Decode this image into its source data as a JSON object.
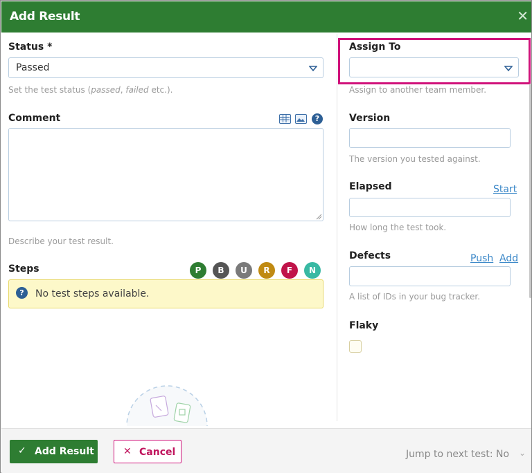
{
  "dialog": {
    "title": "Add Result",
    "close_icon": "close-icon"
  },
  "status": {
    "label": "Status",
    "required_mark": "*",
    "value": "Passed",
    "hint_prefix": "Set the test status (",
    "hint_italic_1": "passed",
    "hint_sep": ", ",
    "hint_italic_2": "failed",
    "hint_suffix": " etc.)."
  },
  "comment": {
    "label": "Comment",
    "value": "",
    "hint": "Describe your test result.",
    "toolbar_icons": [
      "table-icon",
      "image-icon",
      "help-icon"
    ]
  },
  "steps": {
    "label": "Steps",
    "statuses": [
      {
        "letter": "P",
        "name": "passed",
        "color": "#2e7d32"
      },
      {
        "letter": "B",
        "name": "blocked",
        "color": "#555555"
      },
      {
        "letter": "U",
        "name": "untested",
        "color": "#7a7a7a"
      },
      {
        "letter": "R",
        "name": "retest",
        "color": "#c08a12"
      },
      {
        "letter": "F",
        "name": "failed",
        "color": "#c0144a"
      },
      {
        "letter": "N",
        "name": "not-applicable",
        "color": "#38b9a3"
      }
    ],
    "empty_message": "No test steps available."
  },
  "assign_to": {
    "label": "Assign To",
    "value": "",
    "hint": "Assign to another team member."
  },
  "version": {
    "label": "Version",
    "value": "",
    "hint": "The version you tested against."
  },
  "elapsed": {
    "label": "Elapsed",
    "action": "Start",
    "value": "",
    "hint": "How long the test took."
  },
  "defects": {
    "label": "Defects",
    "action_push": "Push",
    "action_add": "Add",
    "value": "",
    "hint": "A list of IDs in your bug tracker."
  },
  "flaky": {
    "label": "Flaky",
    "checked": false
  },
  "footer": {
    "add_result_label": "Add Result",
    "cancel_label": "Cancel",
    "jump_label": "Jump to next test: No"
  },
  "colors": {
    "brand_green": "#2e7d32",
    "highlight": "#d0117a",
    "link": "#3a87c8"
  }
}
